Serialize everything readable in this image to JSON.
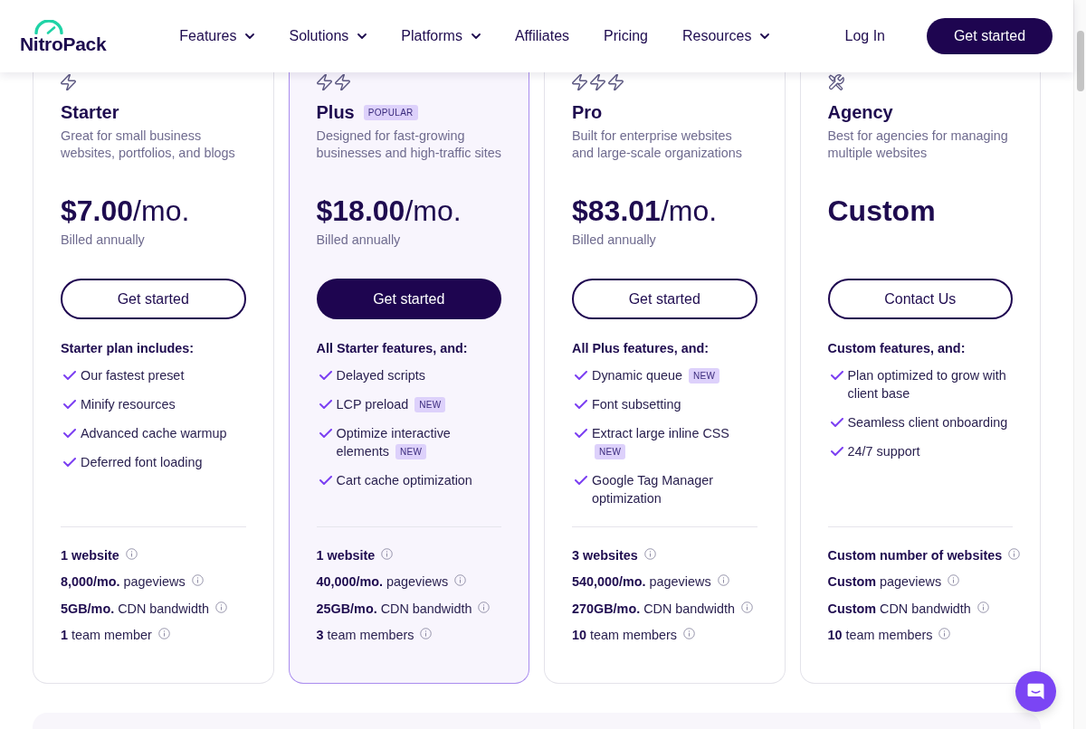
{
  "header": {
    "logo": "NitroPack",
    "nav": [
      {
        "label": "Features",
        "dropdown": true
      },
      {
        "label": "Solutions",
        "dropdown": true
      },
      {
        "label": "Platforms",
        "dropdown": true
      },
      {
        "label": "Affiliates",
        "dropdown": false
      },
      {
        "label": "Pricing",
        "dropdown": false
      },
      {
        "label": "Resources",
        "dropdown": true
      }
    ],
    "login": "Log In",
    "cta": "Get started"
  },
  "plans": [
    {
      "tier_icons": [
        {
          "kind": "bolt"
        }
      ],
      "name": "Starter",
      "highlighted": false,
      "description": "Great for small business websites, portfolios, and blogs",
      "price": {
        "amount": "$7.00",
        "unit": "/mo."
      },
      "billing": "Billed annually",
      "button": "Get started",
      "features_heading": "Starter plan includes:",
      "features": [
        {
          "text": "Our fastest preset"
        },
        {
          "text": "Minify resources"
        },
        {
          "text": "Advanced cache warmup"
        },
        {
          "text": "Deferred font loading"
        }
      ],
      "stats": [
        {
          "value": "1 website"
        },
        {
          "value": "8,000/mo.",
          "label": "pageviews"
        },
        {
          "value": "5GB/mo.",
          "label": "CDN bandwidth"
        },
        {
          "value": "1",
          "label": "team member"
        }
      ]
    },
    {
      "tier_icons": [
        {
          "kind": "bolt"
        },
        {
          "kind": "bolt"
        }
      ],
      "name": "Plus",
      "badge": "POPULAR",
      "highlighted": true,
      "description": "Designed for fast-growing businesses and high-traffic sites",
      "price": {
        "amount": "$18.00",
        "unit": "/mo."
      },
      "billing": "Billed annually",
      "button": "Get started",
      "features_heading": "All Starter features, and:",
      "features": [
        {
          "text": "Delayed scripts"
        },
        {
          "text": "LCP preload",
          "badge": "NEW"
        },
        {
          "text": "Optimize interactive elements",
          "badge": "NEW"
        },
        {
          "text": "Cart cache optimization"
        }
      ],
      "stats": [
        {
          "value": "1 website"
        },
        {
          "value": "40,000/mo.",
          "label": "pageviews"
        },
        {
          "value": "25GB/mo.",
          "label": "CDN bandwidth"
        },
        {
          "value": "3",
          "label": "team members"
        }
      ]
    },
    {
      "tier_icons": [
        {
          "kind": "bolt"
        },
        {
          "kind": "bolt"
        },
        {
          "kind": "bolt"
        }
      ],
      "name": "Pro",
      "highlighted": false,
      "description": "Built for enterprise websites and large-scale organizations",
      "price": {
        "amount": "$83.01",
        "unit": "/mo."
      },
      "billing": "Billed annually",
      "button": "Get started",
      "features_heading": "All Plus features, and:",
      "features": [
        {
          "text": "Dynamic queue",
          "badge": "NEW"
        },
        {
          "text": "Font subsetting"
        },
        {
          "text": "Extract large inline CSS",
          "badge": "NEW"
        },
        {
          "text": "Google Tag Manager optimization"
        }
      ],
      "stats": [
        {
          "value": "3 websites"
        },
        {
          "value": "540,000/mo.",
          "label": "pageviews"
        },
        {
          "value": "270GB/mo.",
          "label": "CDN bandwidth"
        },
        {
          "value": "10",
          "label": "team members"
        }
      ]
    },
    {
      "tier_icons": [
        {
          "kind": "tools"
        }
      ],
      "name": "Agency",
      "highlighted": false,
      "description": "Best for agencies for managing multiple websites",
      "price": {
        "amount": "Custom"
      },
      "button": "Contact Us",
      "features_heading": "Custom features, and:",
      "features": [
        {
          "text": "Plan optimized to grow with client base"
        },
        {
          "text": "Seamless client onboarding"
        },
        {
          "text": "24/7 support"
        }
      ],
      "stats": [
        {
          "value": "Custom number of websites"
        },
        {
          "value": "Custom",
          "label": "pageviews"
        },
        {
          "value": "Custom",
          "label": "CDN bandwidth"
        },
        {
          "value": "10",
          "label": "team members"
        }
      ]
    }
  ]
}
